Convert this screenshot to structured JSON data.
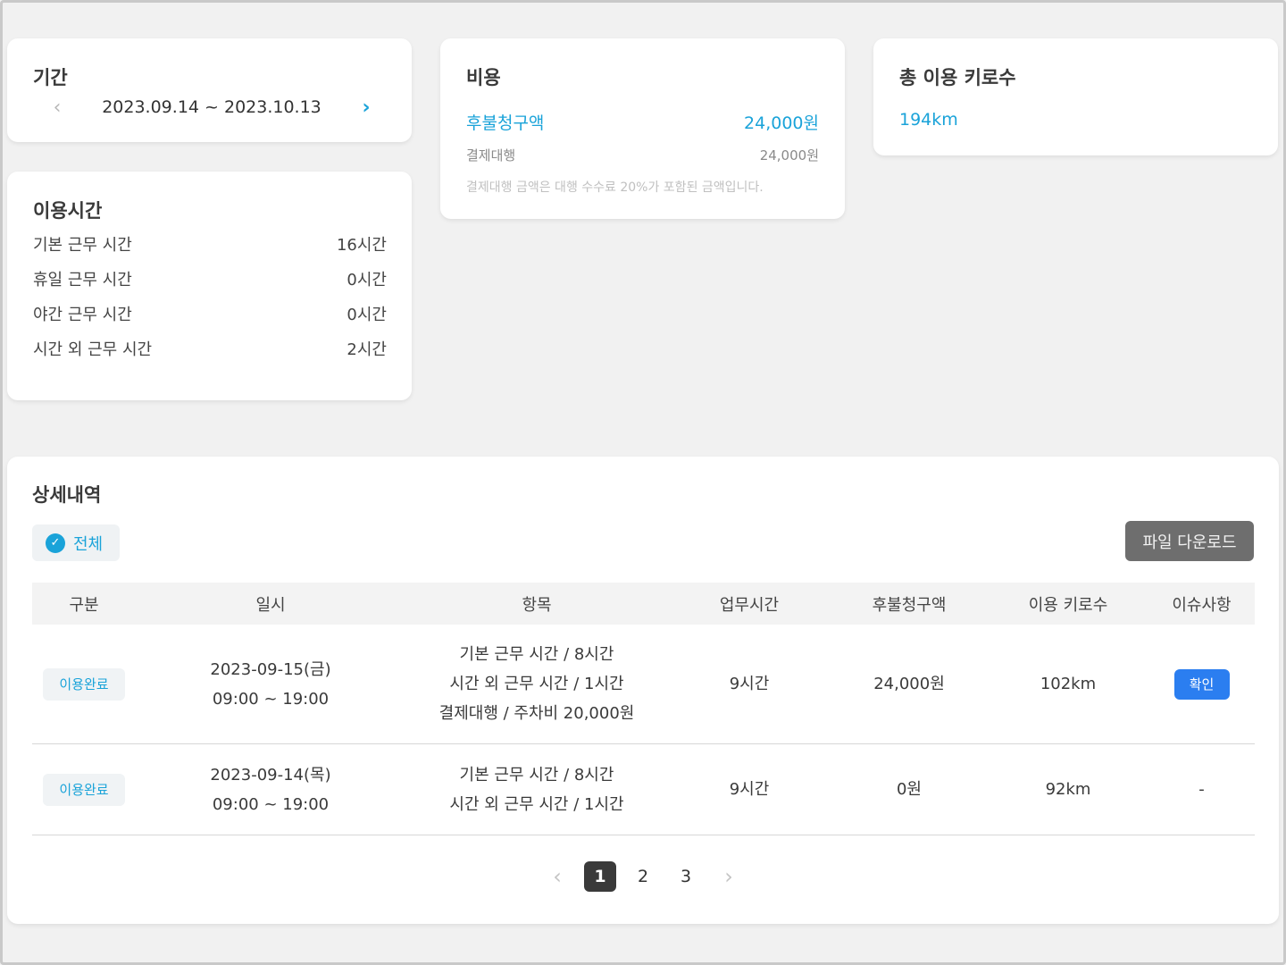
{
  "period": {
    "title": "기간",
    "range": "2023.09.14 ~ 2023.10.13",
    "prev_icon": "‹",
    "next_icon": "›"
  },
  "usage": {
    "title": "이용시간",
    "rows": [
      {
        "label": "기본 근무 시간",
        "value": "16시간"
      },
      {
        "label": "휴일 근무 시간",
        "value": "0시간"
      },
      {
        "label": "야간 근무 시간",
        "value": "0시간"
      },
      {
        "label": "시간 외 근무 시간",
        "value": "2시간"
      }
    ]
  },
  "cost": {
    "title": "비용",
    "main_label": "후불청구액",
    "main_value": "24,000원",
    "sub_label": "결제대행",
    "sub_value": "24,000원",
    "note": "결제대행 금액은 대행 수수료 20%가 포함된 금액입니다."
  },
  "km": {
    "title": "총 이용 키로수",
    "value": "194km"
  },
  "detail": {
    "title": "상세내역",
    "filter_label": "전체",
    "download_label": "파일 다운로드",
    "columns": [
      "구분",
      "일시",
      "항목",
      "업무시간",
      "후불청구액",
      "이용 키로수",
      "이슈사항"
    ],
    "rows": [
      {
        "status": "이용완료",
        "date": "2023-09-15(금)",
        "time": "09:00 ~ 19:00",
        "items": [
          "기본 근무 시간 / 8시간",
          "시간 외 근무 시간 / 1시간",
          "결제대행 / 주차비 20,000원"
        ],
        "work_time": "9시간",
        "amount": "24,000원",
        "km": "102km",
        "issue": "확인"
      },
      {
        "status": "이용완료",
        "date": "2023-09-14(목)",
        "time": "09:00 ~ 19:00",
        "items": [
          "기본 근무 시간 / 8시간",
          "시간 외 근무 시간 / 1시간"
        ],
        "work_time": "9시간",
        "amount": "0원",
        "km": "92km",
        "issue": "-"
      }
    ]
  },
  "pagination": {
    "prev": "‹",
    "pages": [
      "1",
      "2",
      "3"
    ],
    "current": "1",
    "next": "›"
  },
  "colors": {
    "accent": "#1aa3d9",
    "issue_button": "#2b7ef0",
    "download_button": "#6e6e6e"
  }
}
